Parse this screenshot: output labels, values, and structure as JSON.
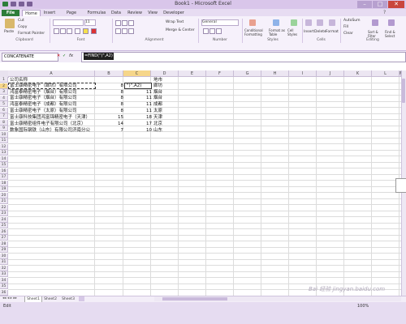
{
  "window": {
    "title": "Book1 - Microsoft Excel",
    "controls": [
      "–",
      "□",
      "✕"
    ]
  },
  "ribbon": {
    "tabs": [
      "File",
      "Home",
      "Insert",
      "Page Layout",
      "Formulas",
      "Data",
      "Review",
      "View",
      "Developer"
    ],
    "clipboard": {
      "paste": "Paste",
      "cut": "Cut",
      "copy": "Copy",
      "format_painter": "Format Painter",
      "label": "Clipboard"
    },
    "font": {
      "name": "",
      "size": "11",
      "label": "Font"
    },
    "alignment": {
      "wrap": "Wrap Text",
      "merge": "Merge & Center",
      "label": "Alignment"
    },
    "number": {
      "format": "General",
      "label": "Number"
    },
    "styles": {
      "conditional": "Conditional Formatting",
      "format_table": "Format as Table",
      "cell_styles": "Cell Styles",
      "label": "Styles"
    },
    "cells": {
      "insert": "Insert",
      "delete": "Delete",
      "format": "Format",
      "label": "Cells"
    },
    "editing": {
      "autosum": "AutoSum",
      "fill": "Fill",
      "clear": "Clear",
      "sort": "Sort & Filter",
      "find": "Find & Select",
      "label": "Editing"
    }
  },
  "formula_bar": {
    "name_box": "CONCATENATE",
    "fx": "fx",
    "formula": "=FIND(\")\",A2)"
  },
  "columns": [
    "A",
    "B",
    "C",
    "D",
    "E",
    "F",
    "G",
    "H",
    "I",
    "J",
    "K",
    "L",
    "M",
    "N"
  ],
  "rows": [
    "1",
    "2",
    "3",
    "4",
    "5",
    "6",
    "7",
    "8",
    "9",
    "10",
    "11",
    "12",
    "13",
    "14",
    "15",
    "16",
    "17",
    "18",
    "19",
    "20",
    "21",
    "22",
    "23",
    "24",
    "25",
    "26",
    "27",
    "28",
    "29",
    "30",
    "31",
    "32",
    "33",
    "34",
    "35",
    "36",
    "37"
  ],
  "cells": {
    "a1": "公司名称",
    "d1": "地市",
    "a2": "富士康精密电子（廊坊）有限公司",
    "a3": "鸿富泰精密电子（烟台）有限公司",
    "a4": "富士康精密电子（烟台）有限公司",
    "a5": "鸿富泰精密电子（成都）有限公司",
    "a6": "富士康精密电子（太原）有限公司",
    "a7": "富士康科技集团鸿富锦精密电子（天津）",
    "a8": "富士康精密组件电子有限公司（北京）",
    "a9": "数象国际钢铁（山东）有限公司济南分公",
    "b2": "8",
    "b3": "8",
    "b4": "8",
    "b5": "8",
    "b6": "8",
    "b7": "15",
    "b8": "14",
    "b9": "7",
    "c2": "\")\",A2)",
    "c3": "11",
    "c4": "11",
    "c5": "11",
    "c6": "11",
    "c7": "18",
    "c8": "17",
    "c9": "10",
    "d2": "廊坊",
    "d3": "烟台",
    "d4": "烟台",
    "d5": "成都",
    "d6": "太原",
    "d7": "天津",
    "d8": "北京",
    "d9": "山东"
  },
  "sheets": [
    "Sheet1",
    "Sheet2",
    "Sheet3"
  ],
  "status": {
    "ready": "Edit",
    "zoom": "100%"
  },
  "watermark": "Bai 经验  jingyan.baidu.com"
}
